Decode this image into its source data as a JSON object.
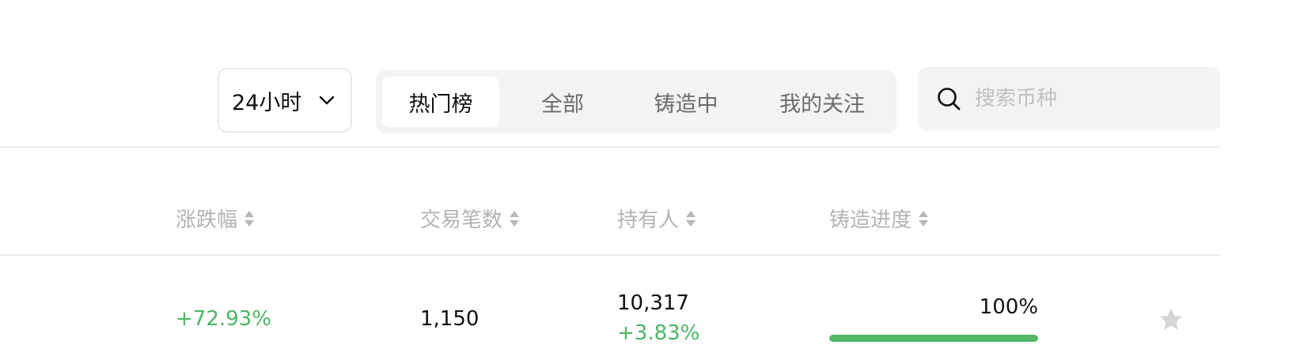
{
  "toolbar": {
    "time_range": {
      "selected": "24小时"
    },
    "tabs": [
      {
        "label": "热门榜",
        "active": true
      },
      {
        "label": "全部",
        "active": false
      },
      {
        "label": "铸造中",
        "active": false
      },
      {
        "label": "我的关注",
        "active": false
      }
    ],
    "search": {
      "placeholder": "搜索币种",
      "value": ""
    }
  },
  "table": {
    "headers": [
      "涨跌幅",
      "交易笔数",
      "持有人",
      "铸造进度"
    ],
    "rows": [
      {
        "change": "+72.93%",
        "trades": "1,150",
        "holders": "10,317",
        "holders_change": "+3.83%",
        "mint_progress": "100%",
        "mint_progress_value": 100
      }
    ]
  },
  "colors": {
    "positive": "#4bb564",
    "progress_fill": "#52b867",
    "header_text": "#b3b3b3",
    "tab_group_bg": "#f3f3f3"
  },
  "icons": [
    "chevron-down-icon",
    "search-icon",
    "sort-icon",
    "star-icon"
  ]
}
